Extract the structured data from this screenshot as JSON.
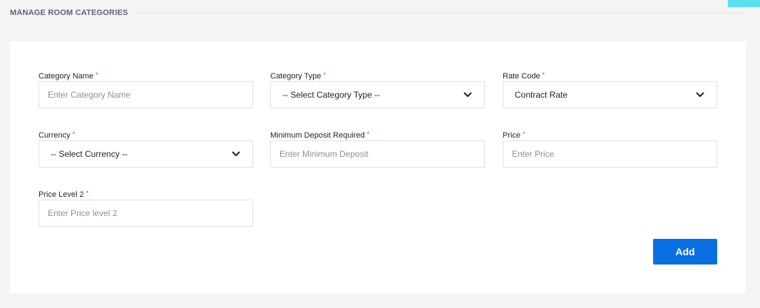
{
  "header": {
    "title": "MANAGE ROOM CATEGORIES"
  },
  "colors": {
    "accent": "#0b6fe4",
    "required": "#e5383b",
    "tab": "#5ee0f0"
  },
  "required_mark": "*",
  "fields": {
    "category_name": {
      "label": "Category Name",
      "placeholder": "Enter Category Name"
    },
    "category_type": {
      "label": "Category Type",
      "value": "-- Select Category Type --"
    },
    "rate_code": {
      "label": "Rate Code",
      "value": "Contract Rate"
    },
    "currency": {
      "label": "Currency",
      "value": "-- Select Currency --"
    },
    "minimum_deposit": {
      "label": "Minimum Deposit Required",
      "placeholder": "Enter Minimum Deposit"
    },
    "price": {
      "label": "Price",
      "placeholder": "Enter Price"
    },
    "price_level_2": {
      "label": "Price Level 2",
      "placeholder": "Enter Price level 2"
    }
  },
  "actions": {
    "add_label": "Add"
  },
  "icons": {
    "select_arrow": "chevron-down-icon"
  }
}
